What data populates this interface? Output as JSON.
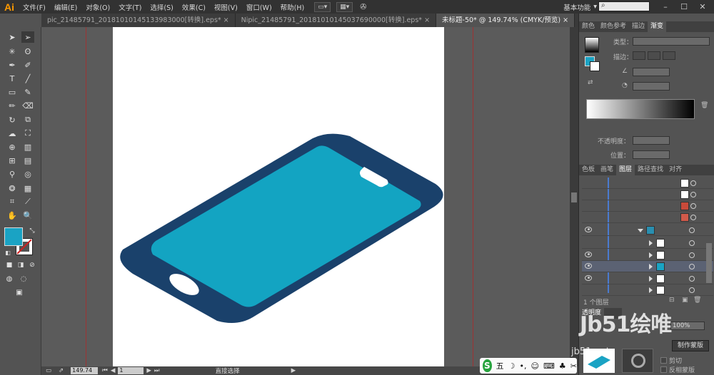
{
  "app": {
    "logo": "Ai",
    "workspace": "基本功能"
  },
  "menu": [
    "文件(F)",
    "编辑(E)",
    "对象(O)",
    "文字(T)",
    "选择(S)",
    "效果(C)",
    "视图(V)",
    "窗口(W)",
    "帮助(H)"
  ],
  "tabs": [
    {
      "label": "pic_21485791_20181010145133983000[转换].eps*",
      "active": false
    },
    {
      "label": "Nipic_21485791_20181010145037690000[转换].eps*",
      "active": false
    },
    {
      "label": "未标题-50* @ 149.74% (CMYK/预览)",
      "active": true
    }
  ],
  "tab_close": "×",
  "colors": {
    "fill": "#1aa3c4",
    "phone_body": "#1a416b",
    "phone_screen": "#13a4c2",
    "guide": "#b02828",
    "accent_orange": "#ff9a00"
  },
  "panels": {
    "top_tabs": [
      "颜色",
      "颜色参考",
      "描边",
      "渐变"
    ],
    "gradient": {
      "type_label": "类型：",
      "stroke_label": "描边：",
      "opacity_label": "不透明度：",
      "position_label": "位置："
    },
    "mid_tabs": [
      "色板",
      "画笔",
      "图层",
      "路径查找",
      "对齐"
    ],
    "layers_count": "1 个图层",
    "bottom_tab": "透明度",
    "bottom_pct": "100%",
    "bottom_btn": "制作蒙版",
    "clip_label": "剪切",
    "invert_label": "反相蒙版"
  },
  "status": {
    "zoom": "149.74",
    "artboard": "1",
    "tool": "直接选择"
  },
  "ime": {
    "logo": "S",
    "mode": "五"
  },
  "watermark": {
    "big": "Jb51绘唯",
    "small": "jb51.net"
  }
}
